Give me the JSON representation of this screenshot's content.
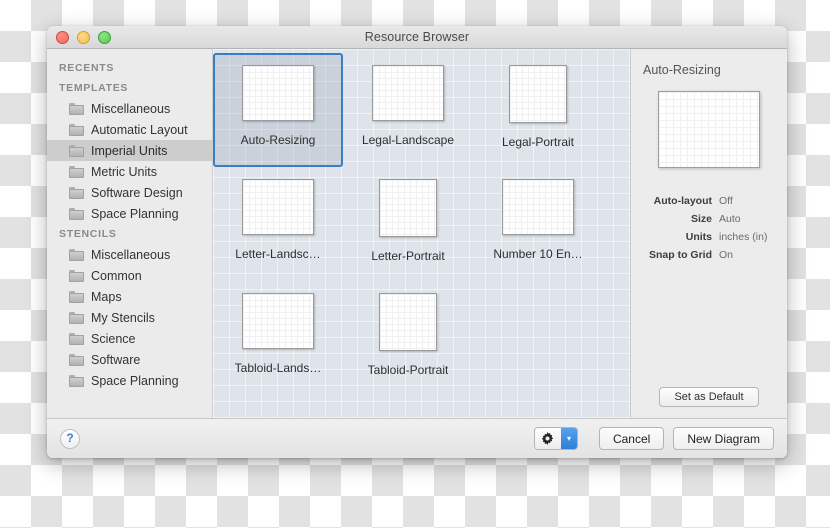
{
  "window": {
    "title": "Resource Browser",
    "traffic_lights": [
      "close",
      "minimize",
      "maximize"
    ]
  },
  "sidebar": {
    "groups": [
      {
        "header": "RECENTS",
        "items": []
      },
      {
        "header": "TEMPLATES",
        "items": [
          {
            "label": "Miscellaneous",
            "selected": false
          },
          {
            "label": "Automatic Layout",
            "selected": false
          },
          {
            "label": "Imperial Units",
            "selected": true
          },
          {
            "label": "Metric Units",
            "selected": false
          },
          {
            "label": "Software Design",
            "selected": false
          },
          {
            "label": "Space Planning",
            "selected": false
          }
        ]
      },
      {
        "header": "STENCILS",
        "items": [
          {
            "label": "Miscellaneous",
            "selected": false
          },
          {
            "label": "Common",
            "selected": false
          },
          {
            "label": "Maps",
            "selected": false
          },
          {
            "label": "My Stencils",
            "selected": false
          },
          {
            "label": "Science",
            "selected": false
          },
          {
            "label": "Software",
            "selected": false
          },
          {
            "label": "Space Planning",
            "selected": false
          }
        ]
      }
    ]
  },
  "templates": {
    "items": [
      {
        "label": "Auto-Resizing",
        "orientation": "landscape",
        "selected": true
      },
      {
        "label": "Legal-Landscape",
        "orientation": "landscape",
        "selected": false
      },
      {
        "label": "Legal-Portrait",
        "orientation": "portrait",
        "selected": false
      },
      {
        "label": "Letter-Landsc…",
        "orientation": "landscape",
        "selected": false
      },
      {
        "label": "Letter-Portrait",
        "orientation": "portrait",
        "selected": false
      },
      {
        "label": "Number 10 En…",
        "orientation": "landscape",
        "selected": false
      },
      {
        "label": "Tabloid-Lands…",
        "orientation": "landscape",
        "selected": false
      },
      {
        "label": "Tabloid-Portrait",
        "orientation": "portrait",
        "selected": false
      }
    ]
  },
  "inspector": {
    "title": "Auto-Resizing",
    "attributes": [
      {
        "key": "Auto-layout",
        "value": "Off"
      },
      {
        "key": "Size",
        "value": "Auto"
      },
      {
        "key": "Units",
        "value": "inches (in)"
      },
      {
        "key": "Snap to Grid",
        "value": "On"
      }
    ],
    "set_default_label": "Set as Default"
  },
  "footer": {
    "help_label": "?",
    "gear_icon": "gear-icon",
    "gear_arrow": "▾",
    "cancel_label": "Cancel",
    "new_diagram_label": "New Diagram"
  },
  "colors": {
    "selection_border": "#3b7cc4",
    "accent_blue": "#2f7fd8",
    "sidebar_bg": "#ebebeb",
    "canvas_bg": "#dfe3ea"
  }
}
